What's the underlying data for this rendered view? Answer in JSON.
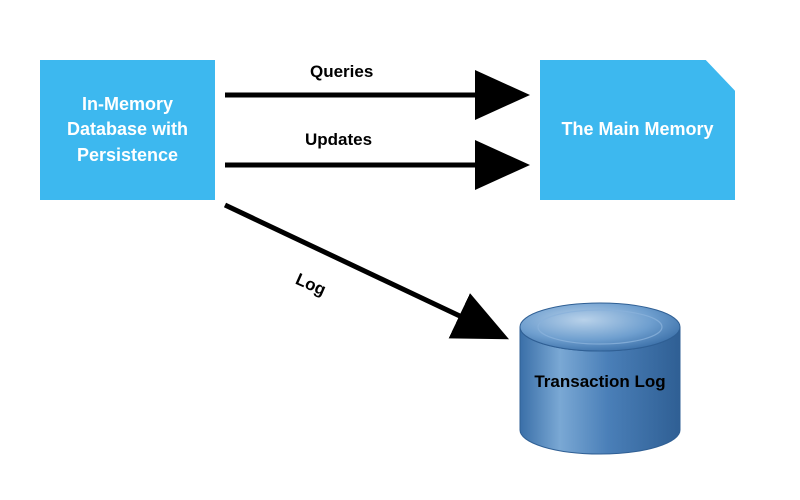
{
  "boxes": {
    "left": {
      "label": "In-Memory Database with Persistence"
    },
    "right": {
      "label": "The Main Memory"
    }
  },
  "arrows": {
    "queries": {
      "label": "Queries"
    },
    "updates": {
      "label": "Updates"
    },
    "log": {
      "label": "Log"
    }
  },
  "cylinder": {
    "label": "Transaction Log"
  },
  "colors": {
    "box_fill": "#3db8ef",
    "cylinder_fill": "#4a7fb8",
    "cylinder_light": "#7aa8d4",
    "arrow": "#000000"
  }
}
